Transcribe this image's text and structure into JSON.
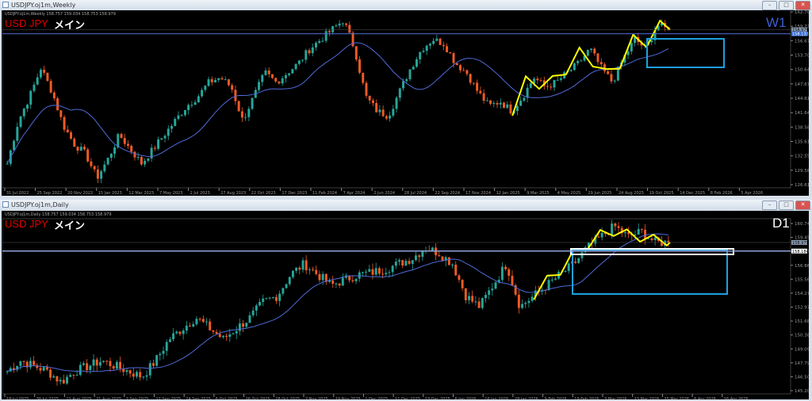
{
  "weekly": {
    "title": "USDJPY.oj1m,Weekly",
    "header": "USDJPY.oj1m,Weekly  158.757 159.034 158.753 158.979",
    "symbol": "USD JPY",
    "label": "メイン",
    "timeframe": "W1",
    "timeframe_color": "#3a5fcd",
    "price_ticks": [
      "162.700",
      "159.730",
      "156.670",
      "153.700",
      "150.640",
      "147.670",
      "144.610",
      "141.640",
      "138.580",
      "135.610",
      "132.550",
      "129.580",
      "126.610"
    ],
    "price_range": [
      126.61,
      162.7
    ],
    "bid_label": "158.979",
    "ask_label": "158.133",
    "date_ticks": [
      "31 Jul 2022",
      "25 Sep 2022",
      "20 Nov 2022",
      "15 Jan 2023",
      "12 Mar 2023",
      "7 May 2023",
      "2 Jul 2023",
      "27 Aug 2023",
      "22 Oct 2023",
      "17 Dec 2023",
      "11 Feb 2024",
      "7 Apr 2024",
      "2 Jun 2024",
      "28 Jul 2024",
      "22 Sep 2024",
      "17 Nov 2024",
      "12 Jan 2025",
      "9 Mar 2025",
      "4 May 2025",
      "29 Jun 2025",
      "24 Aug 2025",
      "19 Oct 2025",
      "14 Dec 2025",
      "8 Feb 2026",
      "5 Apr 2026"
    ],
    "path": [
      131,
      140,
      145,
      151,
      146,
      139,
      135,
      133,
      128,
      132,
      137,
      134,
      131,
      134,
      137,
      140,
      143,
      145,
      148,
      149,
      147,
      140,
      145,
      150,
      148,
      150,
      152,
      155,
      157,
      159,
      161,
      155,
      145,
      142,
      141,
      146,
      151,
      155,
      157,
      156,
      152,
      150,
      146,
      143,
      144,
      142,
      145,
      149,
      147,
      148,
      150,
      152,
      155,
      151,
      148,
      153,
      157,
      155,
      160,
      158.979
    ]
  },
  "daily": {
    "title": "USDJPY.oj1m,Daily",
    "header": "USDJPY.oj1m,Daily  158.757 159.034 158.753 158.979",
    "symbol": "USD JPY",
    "label": "メイン",
    "timeframe": "D1",
    "timeframe_color": "#ffffff",
    "price_ticks": [
      "160.745",
      "159.450",
      "158.155",
      "156.860",
      "155.565",
      "154.270",
      "152.975",
      "151.680",
      "150.385",
      "149.090",
      "147.795",
      "146.500",
      "145.205"
    ],
    "price_range": [
      145.205,
      160.745
    ],
    "bid_label": "158.979",
    "line_label": "158.184",
    "date_ticks": [
      "18 Jul 2025",
      "30 Jul 2025",
      "11 Aug 2025",
      "21 Aug 2025",
      "2 Sep 2025",
      "12 Sep 2025",
      "24 Sep 2025",
      "6 Oct 2025",
      "16 Oct 2025",
      "28 Oct 2025",
      "7 Nov 2025",
      "19 Nov 2025",
      "1 Dec 2025",
      "11 Dec 2025",
      "23 Dec 2025",
      "6 Jan 2026",
      "16 Jan 2026",
      "28 Jan 2026",
      "9 Feb 2026",
      "19 Feb 2026",
      "3 Mar 2026",
      "13 Mar 2026",
      "25 Mar 2026",
      "6 Apr 2026",
      "16 Apr 2026"
    ],
    "path": [
      147,
      148,
      147.5,
      147,
      146,
      147,
      147.5,
      148,
      147.5,
      147,
      146.5,
      148,
      150,
      151,
      152,
      151,
      150,
      151,
      152,
      153.5,
      154,
      156,
      157,
      156,
      155,
      155.5,
      156,
      156.2,
      156.5,
      157,
      157.5,
      158.5,
      158,
      157,
      154,
      153,
      155,
      157,
      153,
      154,
      155,
      156,
      157,
      158.5,
      159.5,
      160.5,
      159.5,
      160,
      159,
      158.979
    ]
  },
  "colors": {
    "up": "#26a69a",
    "down": "#ef5b25",
    "ma": "#4f6bd8",
    "zigzag": "#ffff00",
    "box": "#1ea0e0"
  }
}
